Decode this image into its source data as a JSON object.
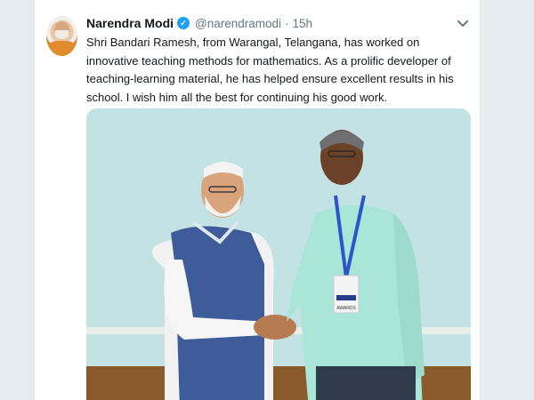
{
  "tweet": {
    "author_name": "Narendra Modi",
    "handle": "@narendramodi",
    "separator": "·",
    "timestamp": "15h",
    "text": "Shri Bandari Ramesh, from Warangal, Telangana, has worked on innovative teaching methods for mathematics. As a prolific developer of teaching-learning material, he has helped ensure excellent results in his school. I wish him all the best for continuing his good work.",
    "verified_icon": "verified-badge-icon",
    "menu_icon": "chevron-down-icon",
    "photo_badge_text": "AWARDS"
  },
  "colors": {
    "background": "#e6ecf0",
    "card": "#ffffff",
    "text": "#14171a",
    "muted": "#657786",
    "verified": "#1da1f2"
  }
}
